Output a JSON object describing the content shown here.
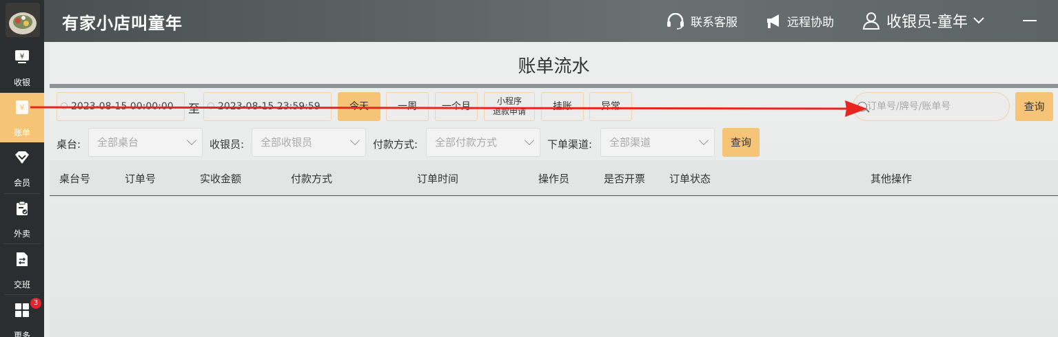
{
  "app": {
    "store_name": "有家小店叫童年",
    "support_label": "联系客服",
    "remote_label": "远程协助",
    "user_label": "收银员-童年"
  },
  "sidebar": {
    "items": [
      {
        "label": "收银",
        "icon": "cashier-icon"
      },
      {
        "label": "账单",
        "icon": "bill-icon",
        "active": true
      },
      {
        "label": "会员",
        "icon": "diamond-icon"
      },
      {
        "label": "外卖",
        "icon": "takeout-icon"
      },
      {
        "label": "交班",
        "icon": "shift-icon"
      },
      {
        "label": "更多",
        "icon": "grid-icon",
        "badge": "3"
      }
    ]
  },
  "page": {
    "title": "账单流水",
    "date_start": "2023-08-15 00:00:00",
    "date_sep": "至",
    "date_end": "2023-08-15 23:59:59",
    "quick": [
      "今天",
      "一周",
      "一个月",
      "小程序",
      "退款申请",
      "挂账",
      "异常"
    ],
    "search_placeholder": "订单号/牌号/账单号",
    "query_label": "查询"
  },
  "filters": [
    {
      "label": "桌台:",
      "value": "全部桌台"
    },
    {
      "label": "收银员:",
      "value": "全部收银员"
    },
    {
      "label": "付款方式:",
      "value": "全部付款方式"
    },
    {
      "label": "下单渠道:",
      "value": "全部渠道"
    }
  ],
  "table": {
    "columns": [
      "桌台号",
      "订单号",
      "实收金额",
      "付款方式",
      "订单时间",
      "操作员",
      "是否开票",
      "订单状态",
      "其他操作"
    ]
  },
  "colors": {
    "accent": "#f6c477",
    "sidebar_bg": "#2b2e30",
    "arrow": "#e8261f"
  }
}
